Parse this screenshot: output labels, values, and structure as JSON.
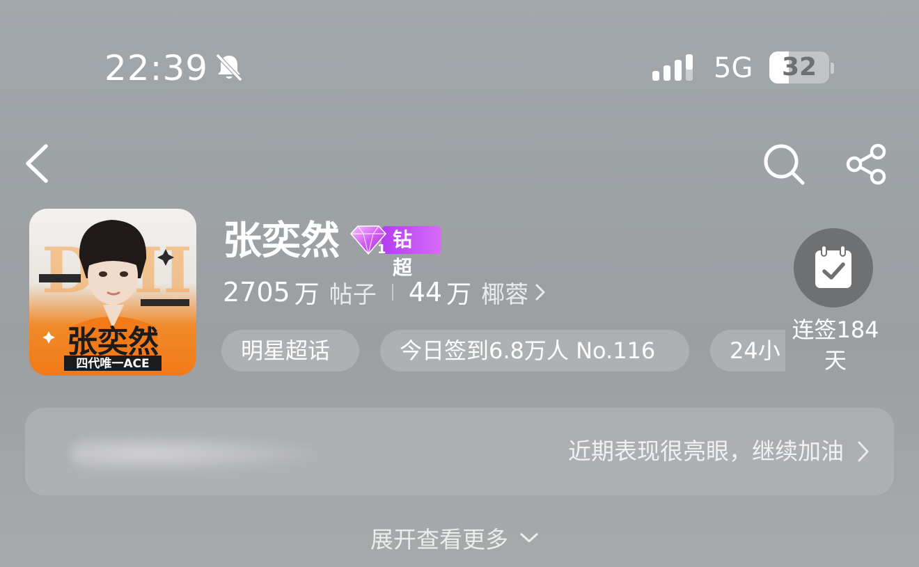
{
  "status_bar": {
    "time": "22:39",
    "network": "5G",
    "battery": "32",
    "icons": [
      "bell-muted-icon",
      "signal-icon",
      "battery-icon"
    ]
  },
  "nav": {
    "icons": [
      "chevron-left-icon",
      "search-icon",
      "share-icon"
    ]
  },
  "profile": {
    "name": "张奕然",
    "badge": {
      "level": "1",
      "label": "钻超",
      "icon": "diamond-icon",
      "colors": [
        "#b23ef0",
        "#d86af8"
      ]
    },
    "avatar": {
      "big_name": "张奕然",
      "caption": "四代唯一ACE"
    },
    "stats": [
      {
        "value": "2705",
        "unit": "万",
        "label": "帖子"
      },
      {
        "value": "44",
        "unit": "万",
        "label": "椰蓉"
      }
    ],
    "tags": [
      "明星超话",
      "今日签到6.8万人 No.116",
      "24小"
    ]
  },
  "checkin": {
    "label": "连签184天",
    "icon": "calendar-check-icon"
  },
  "banner": {
    "text": "近期表现很亮眼，继续加油"
  },
  "expand": {
    "text": "展开查看更多"
  },
  "colors": {
    "accent_orange": "#f27a18",
    "badge_purple": "#b23ef0"
  }
}
